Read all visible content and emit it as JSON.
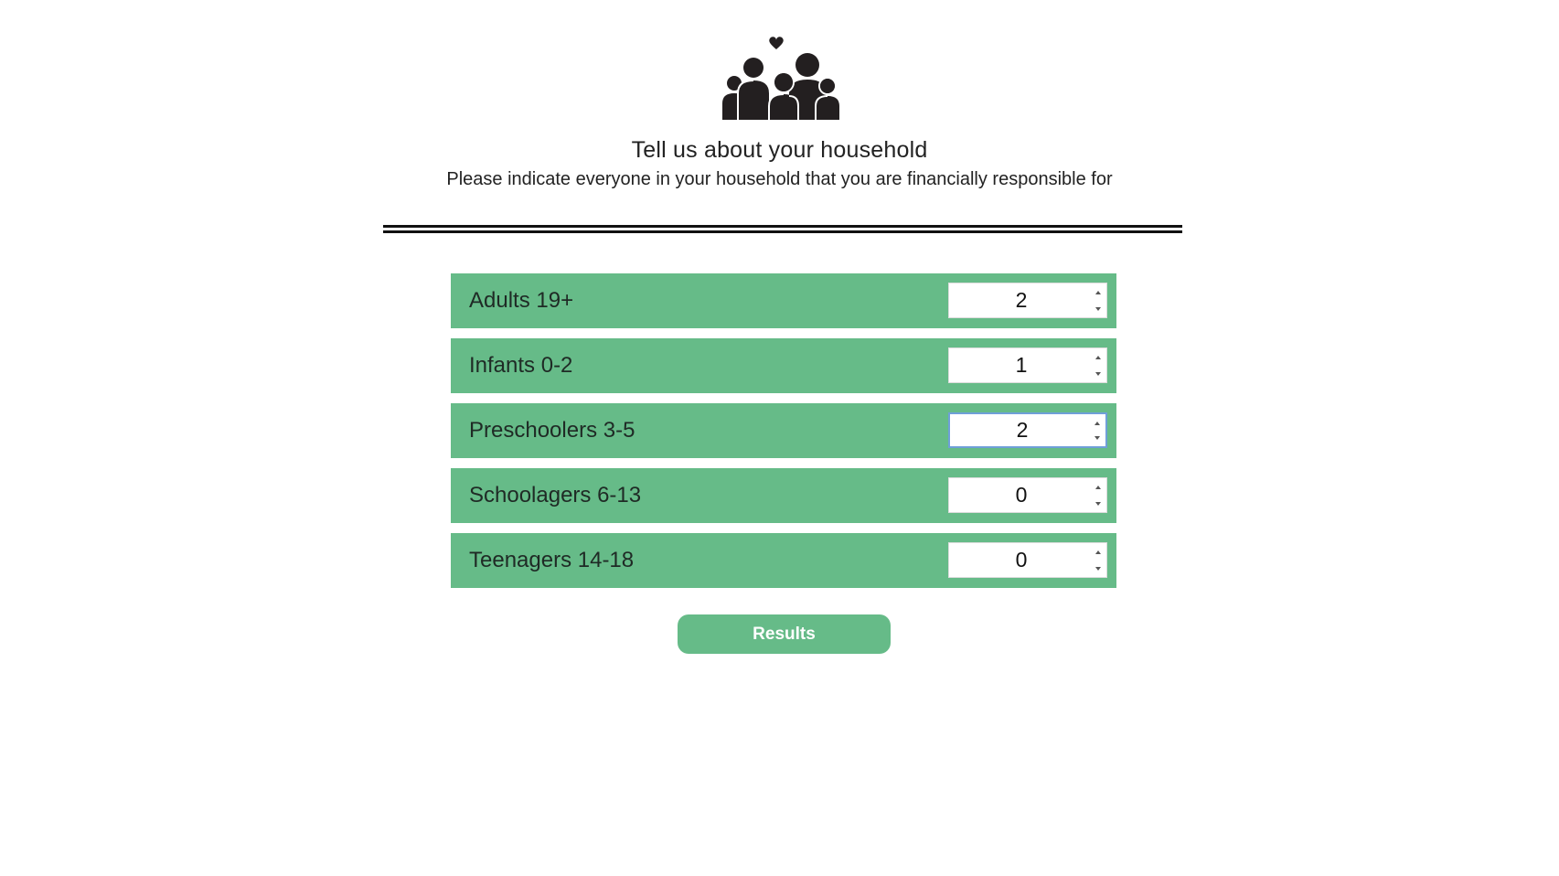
{
  "header": {
    "icon": "family-heart-icon",
    "title": "Tell us about your household",
    "subtitle": "Please indicate everyone in your household that you are financially responsible for"
  },
  "household": {
    "rows": [
      {
        "label": "Adults 19+",
        "value": "2"
      },
      {
        "label": "Infants 0-2",
        "value": "1"
      },
      {
        "label": "Preschoolers 3-5",
        "value": "2",
        "focused": true
      },
      {
        "label": "Schoolagers 6-13",
        "value": "0"
      },
      {
        "label": "Teenagers 14-18",
        "value": "0"
      }
    ]
  },
  "actions": {
    "results_label": "Results"
  },
  "colors": {
    "accent": "#66bb88",
    "text": "#222222",
    "focus": "#6f9fd8"
  }
}
